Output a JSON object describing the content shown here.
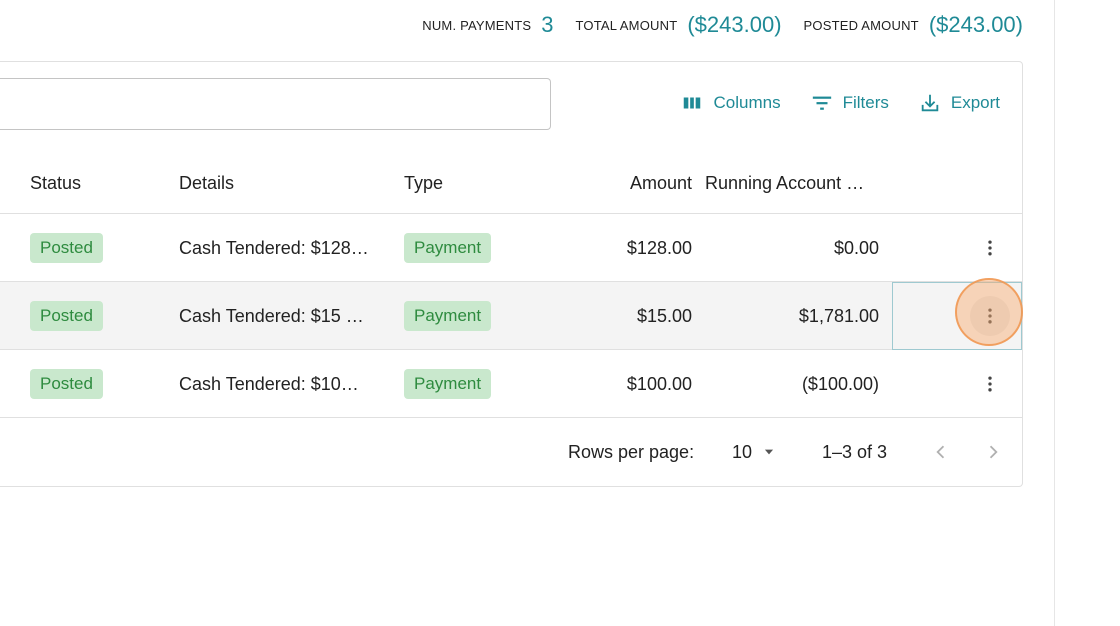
{
  "summary": {
    "num_payments_label": "NUM. PAYMENTS",
    "num_payments_value": "3",
    "total_amount_label": "TOTAL AMOUNT",
    "total_amount_value": "($243.00)",
    "posted_amount_label": "POSTED AMOUNT",
    "posted_amount_value": "($243.00)"
  },
  "search": {
    "placeholder": "",
    "value": ""
  },
  "toolbar": {
    "columns_label": "Columns",
    "filters_label": "Filters",
    "export_label": "Export"
  },
  "columns": {
    "status": "Status",
    "details": "Details",
    "type": "Type",
    "amount": "Amount",
    "running": "Running Account …"
  },
  "rows": [
    {
      "status": "Posted",
      "details": "Cash Tendered: $128…",
      "type": "Payment",
      "amount": "$128.00",
      "running": "$0.00"
    },
    {
      "status": "Posted",
      "details": "Cash Tendered: $15 …",
      "type": "Payment",
      "amount": "$15.00",
      "running": "$1,781.00"
    },
    {
      "status": "Posted",
      "details": "Cash Tendered: $10…",
      "type": "Payment",
      "amount": "$100.00",
      "running": "($100.00)"
    }
  ],
  "footer": {
    "rows_per_page_label": "Rows per page:",
    "rows_per_page_value": "10",
    "range_text": "1–3 of 3"
  },
  "colors": {
    "accent": "#1f8a96",
    "badge_bg": "#c9e8cd",
    "badge_text": "#2e8b3f",
    "click_indicator": "#f8aa6e"
  },
  "icons": {
    "columns": "columns-icon",
    "filters": "filter-icon",
    "export": "download-icon",
    "row_menu": "more-vertical-icon",
    "rows_dropdown": "caret-down-icon",
    "prev": "chevron-left-icon",
    "next": "chevron-right-icon"
  }
}
